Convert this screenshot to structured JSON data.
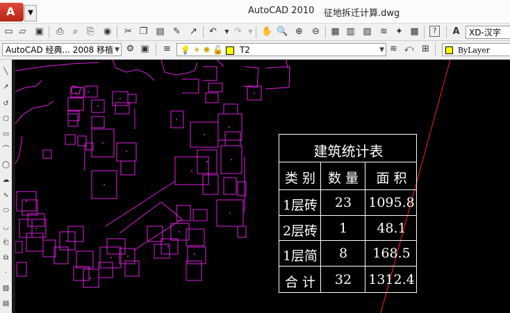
{
  "window": {
    "app_name": "AutoCAD 2010",
    "file_name": "征地拆迁计算.dwg",
    "app_letter": "A"
  },
  "toolbar": {
    "workspace": "AutoCAD 经典... 2008 移植",
    "layer": "T2",
    "color": "ByLayer",
    "text_style": "XD-汉字"
  },
  "table": {
    "title": "建筑统计表",
    "headers": [
      "类 别",
      "数 量",
      "面 积"
    ],
    "rows": [
      {
        "category": "1层砖",
        "count": "23",
        "area": "1095.8"
      },
      {
        "category": "2层砖",
        "count": "1",
        "area": "48.1"
      },
      {
        "category": "1层简",
        "count": "8",
        "area": "168.5"
      },
      {
        "category": "合 计",
        "count": "32",
        "area": "1312.4"
      }
    ]
  },
  "colors": {
    "drawing_bg": "#000000",
    "building_lines": "#e020e0",
    "road_line": "#ff2020",
    "table_lines": "#ffffff"
  }
}
